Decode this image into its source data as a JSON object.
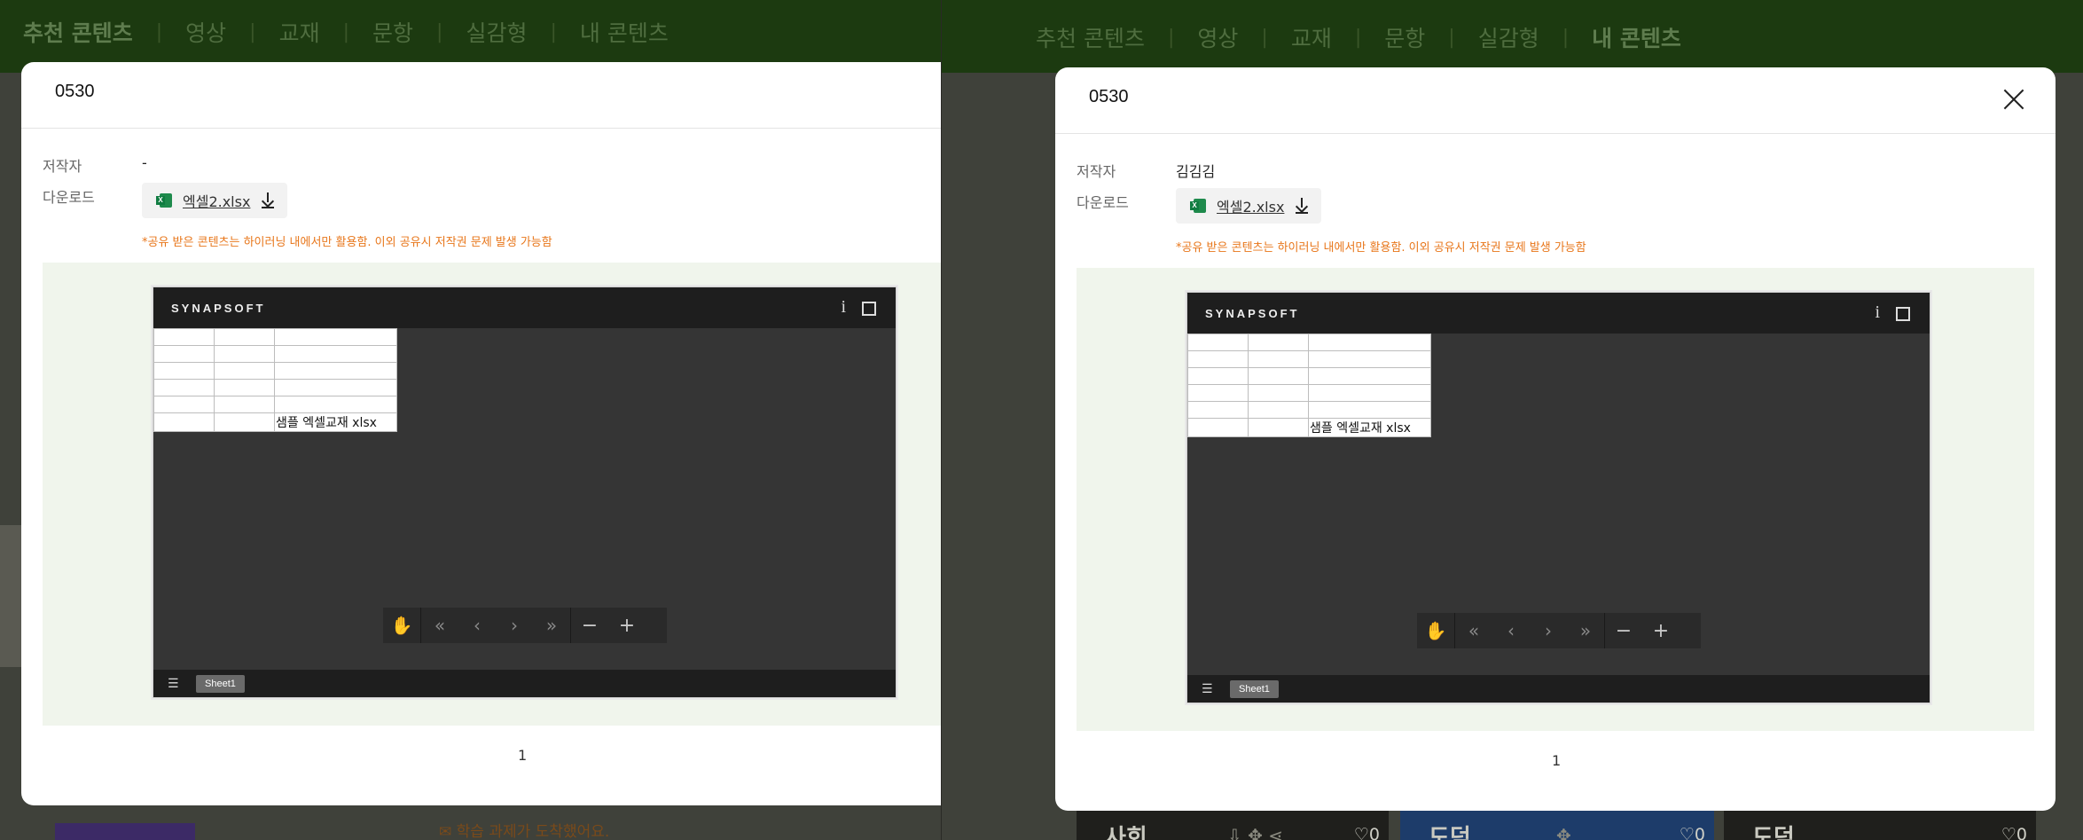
{
  "background": {
    "nav_items": [
      "추천 콘텐츠",
      "영상",
      "교재",
      "문항",
      "실감형",
      "내 콘텐츠"
    ],
    "left_active_index": 0,
    "right_active_index": 5,
    "left_notice": "학습 과제가 도착했어요.",
    "cards": [
      {
        "label": "사회",
        "like_count": "0"
      },
      {
        "label": "도덕",
        "like_count": "0"
      },
      {
        "label": "도덕",
        "like_count": "0"
      }
    ]
  },
  "modals": [
    {
      "title": "0530",
      "author_label": "저작자",
      "author_value": "-",
      "download_label": "다운로드",
      "file_name": "엑셀2.xlsx",
      "notice": "*공유 받은 콘텐츠는 하이러닝 내에서만 활용함. 이외 공유시 저작권 문제 발생 가능함",
      "viewer": {
        "brand": "SYNAPSOFT",
        "info_icon": "i",
        "cell_text": "샘플 엑셀교재 xlsx",
        "sheet_tab": "Sheet1"
      },
      "page_number": "1"
    },
    {
      "title": "0530",
      "author_label": "저작자",
      "author_value": "김김김",
      "download_label": "다운로드",
      "file_name": "엑셀2.xlsx",
      "notice": "*공유 받은 콘텐츠는 하이러닝 내에서만 활용함. 이외 공유시 저작권 문제 발생 가능함",
      "viewer": {
        "brand": "SYNAPSOFT",
        "info_icon": "i",
        "cell_text": "샘플 엑셀교재 xlsx",
        "sheet_tab": "Sheet1"
      },
      "page_number": "1"
    }
  ],
  "colors": {
    "accent_notice": "#e8761a",
    "excel_green": "#107c41",
    "preview_bg": "#f0f5ec",
    "viewer_dark": "#1e1e1e"
  },
  "icons": [
    "close-icon",
    "excel-file-icon",
    "download-icon",
    "info-icon",
    "fullscreen-icon",
    "hand-icon",
    "first-page-icon",
    "prev-page-icon",
    "next-page-icon",
    "last-page-icon",
    "zoom-out-icon",
    "zoom-in-icon",
    "sheet-list-icon"
  ]
}
